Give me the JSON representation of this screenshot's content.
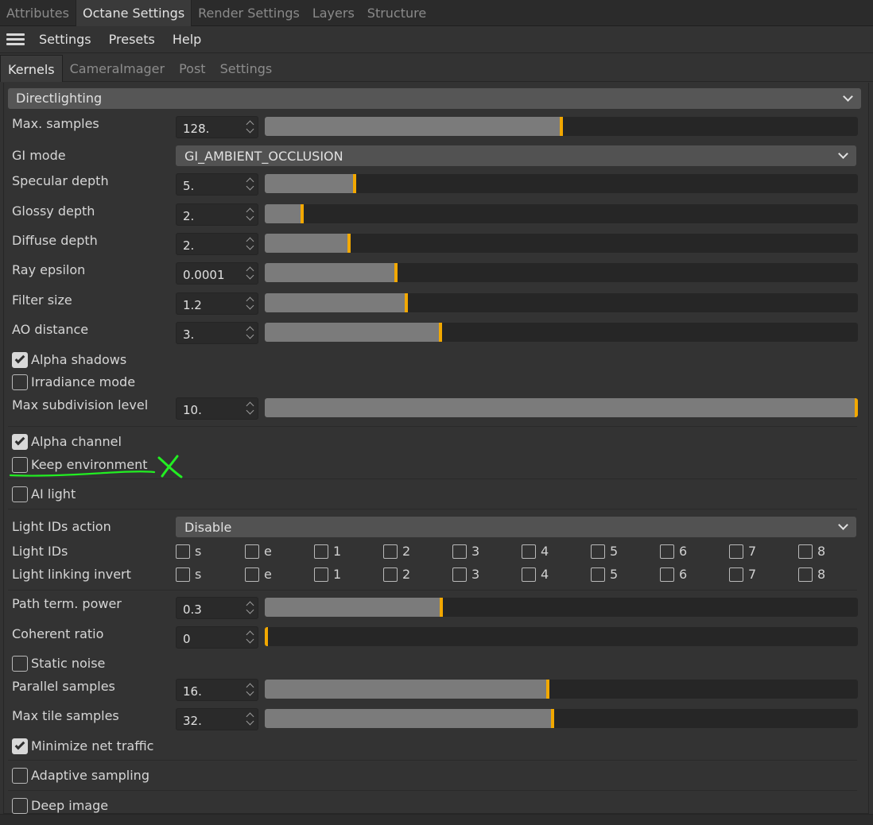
{
  "top_tabs": [
    "Attributes",
    "Octane Settings",
    "Render Settings",
    "Layers",
    "Structure"
  ],
  "menu": [
    "Settings",
    "Presets",
    "Help"
  ],
  "sub_tabs": [
    "Kernels",
    "CameraImager",
    "Post",
    "Settings"
  ],
  "section_title": "Directlighting",
  "max_samples": {
    "label": "Max. samples",
    "value": "128.",
    "fraction": 0.5
  },
  "gi_mode": {
    "label": "GI mode",
    "value": "GI_AMBIENT_OCCLUSION"
  },
  "specular_depth": {
    "label": "Specular depth",
    "value": "5.",
    "fraction": 0.15
  },
  "glossy_depth": {
    "label": "Glossy depth",
    "value": "2.",
    "fraction": 0.06
  },
  "diffuse_depth": {
    "label": "Diffuse depth",
    "value": "2.",
    "fraction": 0.14
  },
  "ray_epsilon": {
    "label": "Ray epsilon",
    "value": "0.0001",
    "fraction": 0.22
  },
  "filter_size": {
    "label": "Filter size",
    "value": "1.2",
    "fraction": 0.237
  },
  "ao_distance": {
    "label": "AO distance",
    "value": "3.",
    "fraction": 0.295
  },
  "alpha_shadows": {
    "label": "Alpha shadows",
    "checked": true
  },
  "irradiance_mode": {
    "label": "Irradiance mode",
    "checked": false
  },
  "max_subdivision": {
    "label": "Max subdivision level",
    "value": "10.",
    "fraction": 1.0
  },
  "alpha_channel": {
    "label": "Alpha channel",
    "checked": true
  },
  "keep_environment": {
    "label": "Keep environment",
    "checked": false
  },
  "ai_light": {
    "label": "AI light",
    "checked": false
  },
  "light_ids_action": {
    "label": "Light IDs action",
    "value": "Disable"
  },
  "light_ids": {
    "label": "Light IDs",
    "items": [
      "s",
      "e",
      "1",
      "2",
      "3",
      "4",
      "5",
      "6",
      "7",
      "8"
    ]
  },
  "light_linking_invert": {
    "label": "Light linking invert",
    "items": [
      "s",
      "e",
      "1",
      "2",
      "3",
      "4",
      "5",
      "6",
      "7",
      "8"
    ]
  },
  "path_term_power": {
    "label": "Path term. power",
    "value": "0.3",
    "fraction": 0.296
  },
  "coherent_ratio": {
    "label": "Coherent ratio",
    "value": "0",
    "fraction": 0.0
  },
  "static_noise": {
    "label": "Static noise",
    "checked": false
  },
  "parallel_samples": {
    "label": "Parallel samples",
    "value": "16.",
    "fraction": 0.477
  },
  "max_tile_samples": {
    "label": "Max tile samples",
    "value": "32.",
    "fraction": 0.485
  },
  "minimize_net_traffic": {
    "label": "Minimize net traffic",
    "checked": true
  },
  "adaptive_sampling": {
    "label": "Adaptive sampling",
    "checked": false
  },
  "deep_image": {
    "label": "Deep image",
    "checked": false
  },
  "colors": {
    "accent_handle": "#f2a800",
    "annotation": "#22ee22"
  }
}
